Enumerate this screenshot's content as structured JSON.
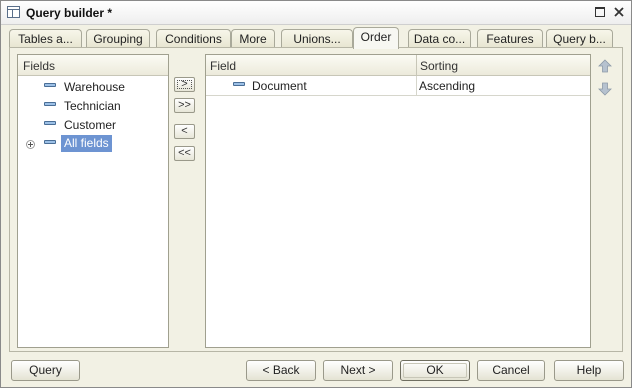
{
  "window": {
    "title": "Query builder *",
    "icons": {
      "app": "table-icon",
      "maximize": "maximize-icon",
      "close": "close-icon"
    }
  },
  "tabs": [
    {
      "label": "Tables a..."
    },
    {
      "label": "Grouping"
    },
    {
      "label": "Conditions"
    },
    {
      "label": "More"
    },
    {
      "label": "Unions..."
    },
    {
      "label": "Order",
      "active": true
    },
    {
      "label": "Data co..."
    },
    {
      "label": "Features"
    },
    {
      "label": "Query b..."
    }
  ],
  "fields_panel": {
    "header": "Fields",
    "items": [
      {
        "label": "Warehouse",
        "icon": "field-icon"
      },
      {
        "label": "Technician",
        "icon": "field-icon"
      },
      {
        "label": "Customer",
        "icon": "field-icon"
      },
      {
        "label": "All fields",
        "icon": "field-icon",
        "expand_icon": "expand-plus-icon",
        "selected": true
      }
    ]
  },
  "transfer_buttons": {
    "add": ">",
    "add_all": ">>",
    "remove": "<",
    "remove_all": "<<"
  },
  "order_panel": {
    "columns": [
      "Field",
      "Sorting"
    ],
    "rows": [
      {
        "field": "Document",
        "sorting": "Ascending",
        "icon": "field-icon"
      }
    ]
  },
  "move_buttons": {
    "up": "arrow-up-icon",
    "down": "arrow-down-icon"
  },
  "footer": {
    "query": "Query",
    "back": "< Back",
    "next": "Next >",
    "ok": "OK",
    "cancel": "Cancel",
    "help": "Help"
  },
  "colors": {
    "selection": "#6d94d2",
    "background": "#f2f1e4",
    "arrow": "#a9b6c6"
  }
}
